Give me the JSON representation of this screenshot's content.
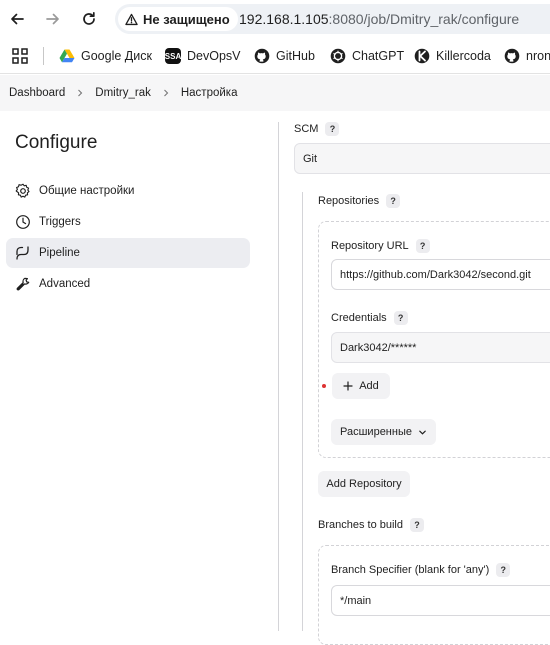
{
  "browser": {
    "security_label": "Не защищено",
    "url_host": "192.168.1.105",
    "url_rest": ":8080/job/Dmitry_rak/configure",
    "bookmarks": [
      {
        "label": "Google Диск",
        "icon": "google-drive-icon"
      },
      {
        "label": "DevOpsV",
        "icon": "ssa-icon",
        "icon_text": "SSA"
      },
      {
        "label": "GitHub",
        "icon": "github-icon"
      },
      {
        "label": "ChatGPT",
        "icon": "chatgpt-icon"
      },
      {
        "label": "Killercoda",
        "icon": "killercoda-icon"
      },
      {
        "label": "nron",
        "icon": "github-icon"
      }
    ]
  },
  "breadcrumb": {
    "items": [
      "Dashboard",
      "Dmitry_rak",
      "Настройка"
    ]
  },
  "sidebar": {
    "title": "Configure",
    "items": [
      {
        "label": "Общие настройки",
        "icon": "gear-icon"
      },
      {
        "label": "Triggers",
        "icon": "clock-icon"
      },
      {
        "label": "Pipeline",
        "icon": "pipeline-icon",
        "active": true
      },
      {
        "label": "Advanced",
        "icon": "wrench-icon"
      }
    ]
  },
  "main": {
    "scm_label": "SCM",
    "scm_value": "Git",
    "help_glyph": "?",
    "repositories_label": "Repositories",
    "repo_url_label": "Repository URL",
    "repo_url_value": "https://github.com/Dark3042/second.git",
    "credentials_label": "Credentials",
    "credentials_value": "Dark3042/******",
    "add_label": "Add",
    "advanced_label": "Расширенные",
    "add_repository_label": "Add Repository",
    "branches_label": "Branches to build",
    "branch_specifier_label": "Branch Specifier (blank for 'any')",
    "branch_specifier_value": "*/main"
  },
  "colors": {
    "active_item_bg": "#ecedf1",
    "required_dot": "#dd3333"
  }
}
